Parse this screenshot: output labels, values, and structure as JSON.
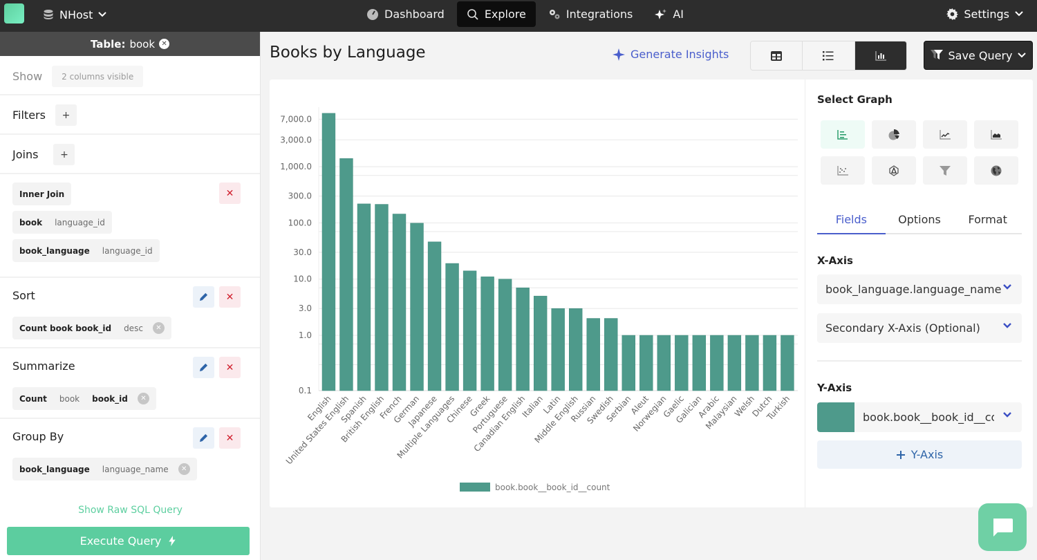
{
  "topbar": {
    "database": "NHost",
    "nav": [
      {
        "label": "Dashboard",
        "icon": "gauge-icon",
        "active": false
      },
      {
        "label": "Explore",
        "icon": "search-icon",
        "active": true
      },
      {
        "label": "Integrations",
        "icon": "gears-icon",
        "active": false
      },
      {
        "label": "AI",
        "icon": "sparkle-icon",
        "active": false
      }
    ],
    "settings": "Settings"
  },
  "left": {
    "table_prefix": "Table:",
    "table_name": "book",
    "show_label": "Show",
    "show_value": "2 columns visible",
    "filters_label": "Filters",
    "joins_label": "Joins",
    "join": {
      "type": "Inner Join",
      "left_table": "book",
      "left_column": "language_id",
      "right_table": "book_language",
      "right_column": "language_id"
    },
    "sort": {
      "label": "Sort",
      "field": "Count book book_id",
      "direction": "desc"
    },
    "summarize": {
      "label": "Summarize",
      "func": "Count",
      "table": "book",
      "column": "book_id"
    },
    "group_by": {
      "label": "Group By",
      "table": "book_language",
      "column": "language_name"
    },
    "raw_sql_link": "Show Raw SQL Query",
    "execute_label": "Execute Query"
  },
  "main": {
    "title": "Books by Language",
    "insights_label": "Generate Insights",
    "view_modes": [
      "table-view",
      "list-view",
      "chart-view"
    ],
    "active_view": "chart-view",
    "save_label": "Save Query"
  },
  "config": {
    "select_graph_label": "Select Graph",
    "graph_types": [
      "bar",
      "pie",
      "line",
      "area",
      "scatter",
      "radar",
      "funnel",
      "map"
    ],
    "active_graph": "bar",
    "tabs": [
      "Fields",
      "Options",
      "Format"
    ],
    "active_tab": "Fields",
    "x_axis_label": "X-Axis",
    "x_axis_value": "book_language.language_name",
    "secondary_x_placeholder": "Secondary X-Axis (Optional)",
    "y_axis_label": "Y-Axis",
    "y_axis_value": "book.book__book_id__count",
    "y_axis_color": "#4e9a8b",
    "add_y_label": "Y-Axis"
  },
  "chart_data": {
    "type": "bar",
    "title": "Books by Language",
    "xlabel": "",
    "ylabel": "",
    "yscale": "log",
    "ylim": [
      0.1,
      9000
    ],
    "y_ticks": [
      0.1,
      1,
      3,
      10,
      30,
      100,
      300,
      1000,
      3000,
      7000
    ],
    "y_tick_labels": [
      "0.1",
      "1.0",
      "3.0",
      "10.0",
      "30.0",
      "100.0",
      "300.0",
      "1,000.0",
      "3,000.0",
      "7,000.0"
    ],
    "grid": true,
    "legend_position": "bottom",
    "categories": [
      "English",
      "United States English",
      "Spanish",
      "British English",
      "French",
      "German",
      "Japanese",
      "Multiple Languages",
      "Chinese",
      "Greek",
      "Portuguese",
      "Canadian English",
      "Italian",
      "Latin",
      "Middle English",
      "Russian",
      "Swedish",
      "Serbian",
      "Aleut",
      "Norwegian",
      "Gaelic",
      "Galician",
      "Arabic",
      "Malaysian",
      "Welsh",
      "Dutch",
      "Turkish"
    ],
    "series": [
      {
        "name": "book.book__book_id__count",
        "color": "#4e9a8b",
        "values": [
          8911,
          1399,
          218,
          214,
          144,
          99,
          46,
          19,
          14,
          11,
          10,
          7,
          5,
          3,
          3,
          2,
          2,
          1,
          1,
          1,
          1,
          1,
          1,
          1,
          1,
          1,
          1
        ]
      }
    ]
  }
}
